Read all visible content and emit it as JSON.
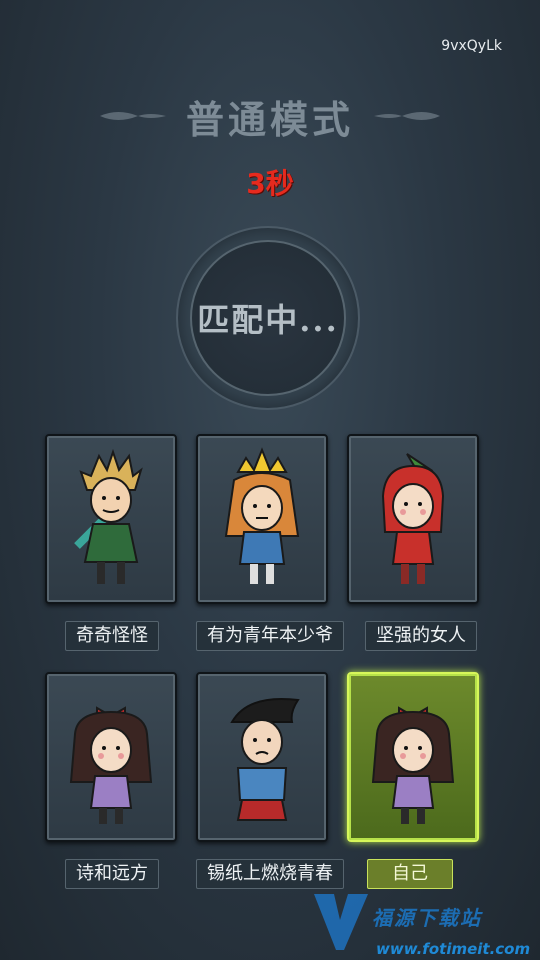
{
  "room_code": "9vxQyLk",
  "mode_title": "普通模式",
  "countdown": "3秒",
  "matching_text": "匹配中...",
  "players": [
    {
      "name": "奇奇怪怪",
      "character": "wilson-style-sword",
      "self": false
    },
    {
      "name": "有为青年本少爷",
      "character": "wendy-crown",
      "self": false
    },
    {
      "name": "坚强的女人",
      "character": "red-hood-girl",
      "self": false
    },
    {
      "name": "诗和远方",
      "character": "willow-bow",
      "self": false
    },
    {
      "name": "锡纸上燃烧青春",
      "character": "maxwell-suit",
      "self": false
    },
    {
      "name": "自己",
      "character": "willow-bow",
      "self": true
    }
  ],
  "watermark": {
    "brand": "福源下载站",
    "url": "www.fotimeit.com"
  },
  "colors": {
    "accent_countdown": "#e62a1e",
    "self_highlight": "#b7e24a"
  }
}
